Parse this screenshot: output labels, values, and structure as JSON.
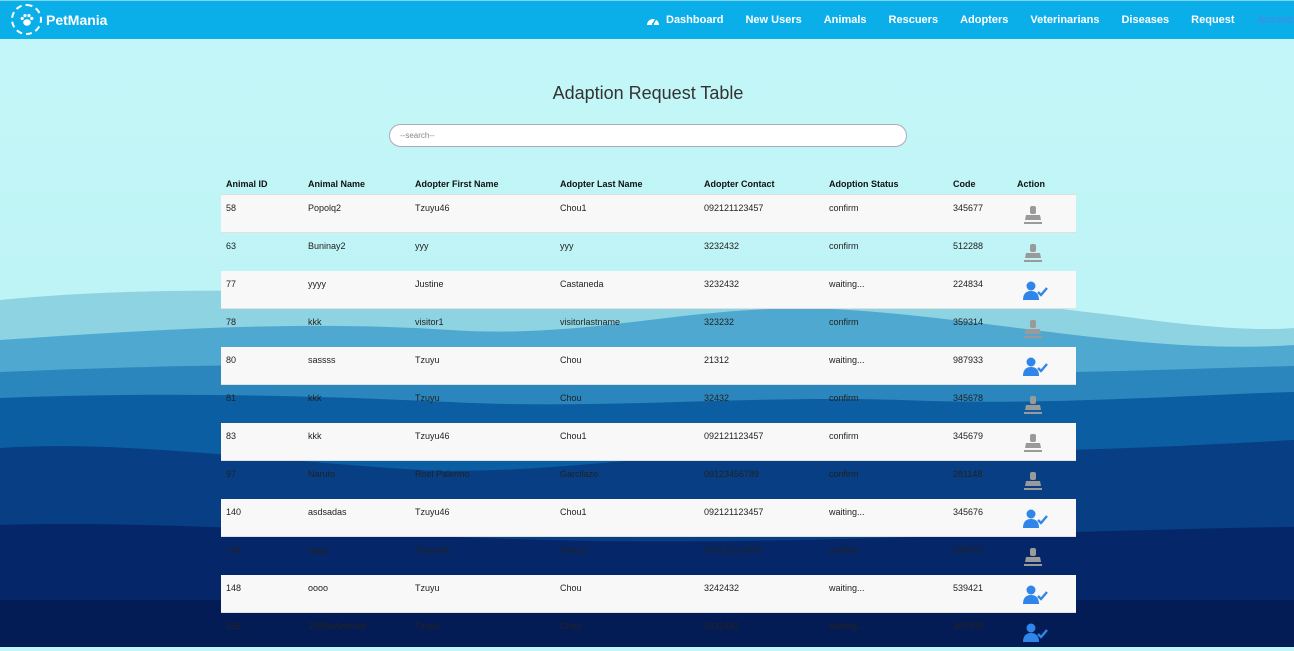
{
  "nav": {
    "brand": "PetMania",
    "items": [
      {
        "label": "Dashboard"
      },
      {
        "label": "New Users"
      },
      {
        "label": "Animals"
      },
      {
        "label": "Rescuers"
      },
      {
        "label": "Adopters"
      },
      {
        "label": "Veterinarians"
      },
      {
        "label": "Diseases"
      },
      {
        "label": "Request"
      },
      {
        "label": "Account"
      }
    ]
  },
  "page_title": "Adaption Request Table",
  "search": {
    "placeholder": "--search--",
    "value": ""
  },
  "table": {
    "columns": [
      "Animal ID",
      "Animal Name",
      "Adopter First Name",
      "Adopter Last Name",
      "Adopter Contact",
      "Adoption Status",
      "Code",
      "Action"
    ],
    "rows": [
      {
        "id": "58",
        "name": "Popolq2",
        "first": "Tzuyu46",
        "last": "Chou1",
        "contact": "092121123457",
        "status": "confirm",
        "code": "345677",
        "action_icon": "user-stamp-icon"
      },
      {
        "id": "63",
        "name": "Buninay2",
        "first": "yyy",
        "last": "yyy",
        "contact": "3232432",
        "status": "confirm",
        "code": "512288",
        "action_icon": "user-stamp-icon"
      },
      {
        "id": "77",
        "name": "yyyy",
        "first": "Justine",
        "last": "Castaneda",
        "contact": "3232432",
        "status": "waiting...",
        "code": "224834",
        "action_icon": "user-check-icon"
      },
      {
        "id": "78",
        "name": "kkk",
        "first": "visitor1",
        "last": "visitorlastname",
        "contact": "323232",
        "status": "confirm",
        "code": "359314",
        "action_icon": "user-stamp-icon"
      },
      {
        "id": "80",
        "name": "sassss",
        "first": "Tzuyu",
        "last": "Chou",
        "contact": "21312",
        "status": "waiting...",
        "code": "987933",
        "action_icon": "user-check-icon"
      },
      {
        "id": "81",
        "name": "kkk",
        "first": "Tzuyu",
        "last": "Chou",
        "contact": "32432",
        "status": "confirm",
        "code": "345678",
        "action_icon": "user-stamp-icon"
      },
      {
        "id": "83",
        "name": "kkk",
        "first": "Tzuyu46",
        "last": "Chou1",
        "contact": "092121123457",
        "status": "confirm",
        "code": "345679",
        "action_icon": "user-stamp-icon"
      },
      {
        "id": "97",
        "name": "Naruto",
        "first": "Roel Palermo",
        "last": "Garcilazo",
        "contact": "09123456789",
        "status": "confirm",
        "code": "281148",
        "action_icon": "user-stamp-icon"
      },
      {
        "id": "140",
        "name": "asdsadas",
        "first": "Tzuyu46",
        "last": "Chou1",
        "contact": "092121123457",
        "status": "waiting...",
        "code": "345676",
        "action_icon": "user-check-icon"
      },
      {
        "id": "144",
        "name": "bago",
        "first": "Tzuyu46",
        "last": "Chou1",
        "contact": "092121123457",
        "status": "confirm",
        "code": "345670",
        "action_icon": "user-stamp-icon"
      },
      {
        "id": "148",
        "name": "oooo",
        "first": "Tzuyu",
        "last": "Chou",
        "contact": "3242432",
        "status": "waiting...",
        "code": "539421",
        "action_icon": "user-check-icon"
      },
      {
        "id": "158",
        "name": "158NaAnimals",
        "first": "Tzuyu",
        "last": "Chou",
        "contact": "3232432",
        "status": "waiting...",
        "code": "467909",
        "action_icon": "user-check-icon"
      }
    ]
  },
  "colors": {
    "navbar": "#0aaee9",
    "accent_icon": "#2f86e8",
    "muted_icon": "#9a9a9a"
  }
}
